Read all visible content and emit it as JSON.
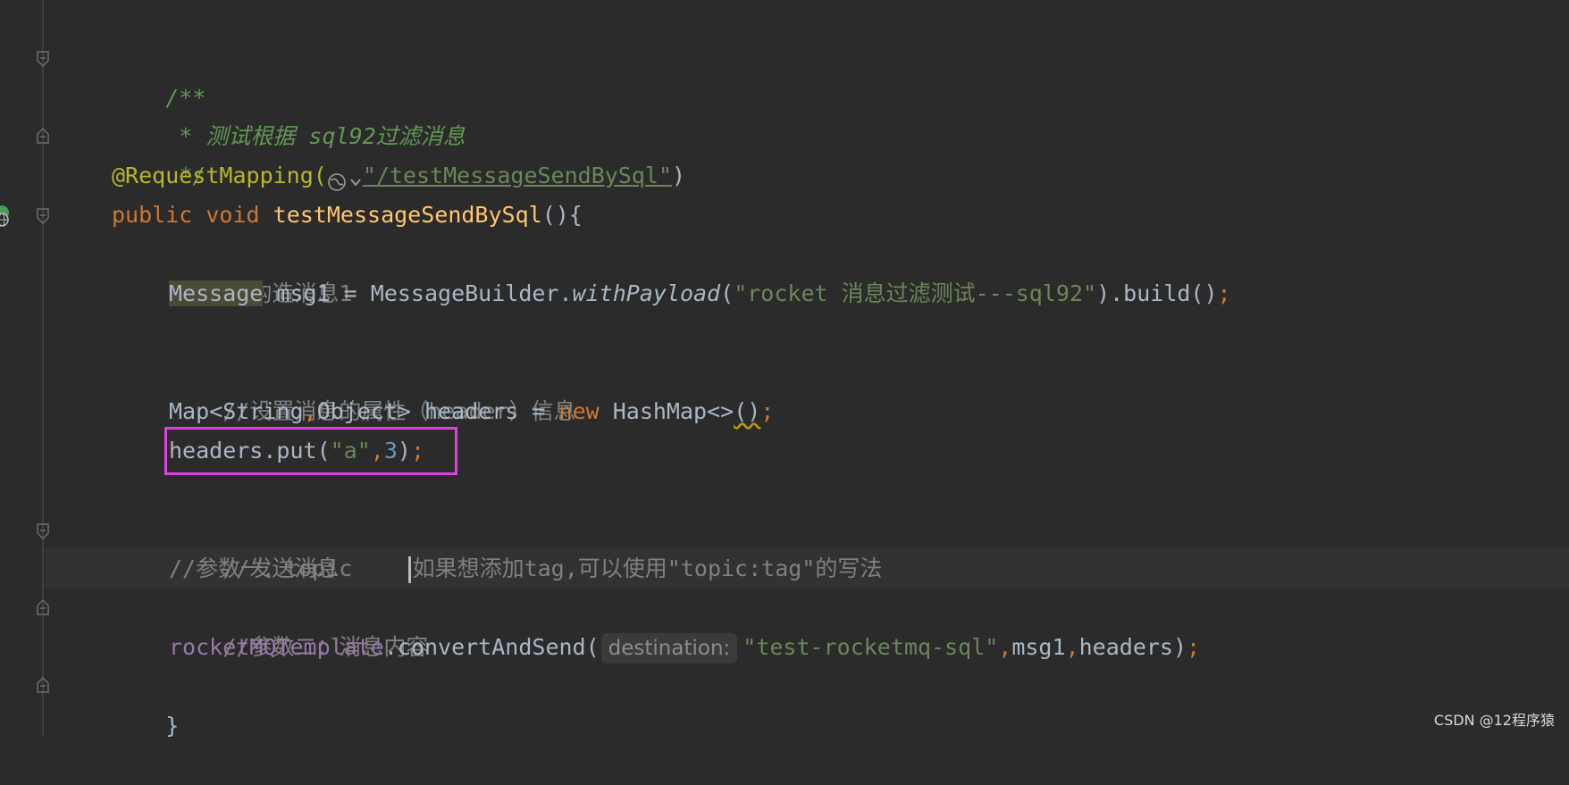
{
  "code": {
    "doc_open": "/**",
    "doc_text": " * 测试根据 sql92过滤消息",
    "doc_close": " */",
    "annotation": "@RequestMapping(",
    "annotation_path": "\"/testMessageSendBySql\"",
    "annotation_close": ")",
    "kw_public": "public",
    "kw_void": "void",
    "method_name": "testMessageSendBySql",
    "method_open": "(){",
    "comment_build": "//构造消息1",
    "type_message": "Message",
    "msg_decl": " msg1 = MessageBuilder.",
    "with_payload": "withPayload",
    "paren_open": "(",
    "payload_str": "\"rocket 消息过滤测试---sql92\"",
    "build_call": ").build()",
    "semi": ";",
    "comment_header": "//设置消息的属性（header）信息",
    "map_type": "Map<String",
    "comma": ",",
    "map_type2": "Object> headers = ",
    "kw_new": "new",
    "hashmap": " HashMap<>",
    "hashmap_call": "()",
    "put_call": "headers.put(",
    "put_key": "\"a\"",
    "put_value": "3",
    "put_close": ")",
    "comment_send": "//发送消息",
    "comment_param1": "//参数一：topic    ",
    "comment_param1_rest": "如果想添加tag,可以使用\"topic:tag\"的写法",
    "comment_param2": "//参数二：消息内容",
    "template_field": "rocketMQTemplate",
    "convert_call": ".convertAndSend(",
    "hint_destination": "destination:",
    "topic_str": "\"test-rocketmq-sql\"",
    "arg_msg": "msg1",
    "arg_headers": "headers",
    "close_paren": ")",
    "brace_close": "}"
  },
  "watermark": "CSDN @12程序猿",
  "colors": {
    "background": "#2b2b2b",
    "highlight_box": "#e040e0",
    "keyword": "#cc7832",
    "string": "#6a8759",
    "comment": "#808080",
    "doc_comment": "#629755"
  }
}
